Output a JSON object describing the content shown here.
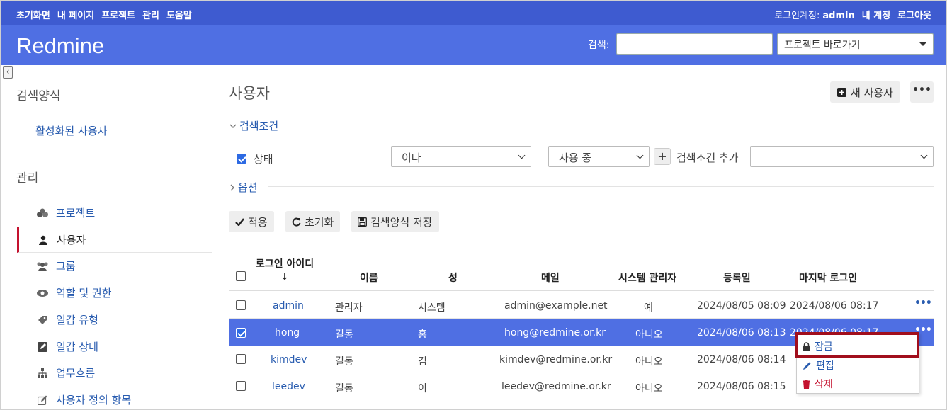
{
  "top_menu": {
    "left": [
      "초기화면",
      "내 페이지",
      "프로젝트",
      "관리",
      "도움말"
    ],
    "login_label": "로그인계정:",
    "login_user": "admin",
    "my_account": "내 계정",
    "logout": "로그아웃"
  },
  "header": {
    "title": "Redmine",
    "search_label": "검색:",
    "search_value": "",
    "jump_label": "프로젝트 바로가기"
  },
  "sidebar": {
    "queries_heading": "검색양식",
    "active_users": "활성화된 사용자",
    "admin_heading": "관리",
    "admin_items": [
      {
        "label": "프로젝트",
        "icon": "projects-icon"
      },
      {
        "label": "사용자",
        "icon": "user-icon"
      },
      {
        "label": "그룹",
        "icon": "group-icon"
      },
      {
        "label": "역할 및 권한",
        "icon": "eye-icon"
      },
      {
        "label": "일감 유형",
        "icon": "tag-icon"
      },
      {
        "label": "일감 상태",
        "icon": "edit-square-icon"
      },
      {
        "label": "업무흐름",
        "icon": "workflow-icon"
      },
      {
        "label": "사용자 정의 항목",
        "icon": "pencil-square-icon"
      }
    ],
    "selected_item": "사용자"
  },
  "main": {
    "title": "사용자",
    "new_user_label": "새 사용자",
    "filters_legend": "검색조건",
    "filter": {
      "label": "상태",
      "operator": "이다",
      "value": "사용 중",
      "add_filter_label": "검색조건 추가",
      "add_filter_value": ""
    },
    "options_legend": "옵션",
    "buttons": {
      "apply": "적용",
      "clear": "초기화",
      "save": "검색양식 저장"
    }
  },
  "table": {
    "headers": {
      "login": "로그인 아이디",
      "sort_mark": "↓",
      "firstname": "이름",
      "lastname": "성",
      "mail": "메일",
      "admin": "시스템 관리자",
      "created": "등록일",
      "last_login": "마지막 로그인"
    },
    "rows": [
      {
        "login": "admin",
        "firstname": "관리자",
        "lastname": "시스템",
        "mail": "admin@example.net",
        "admin": "예",
        "created": "2024/08/05 08:09",
        "last_login": "2024/08/06 08:17",
        "checked": false
      },
      {
        "login": "hong",
        "firstname": "길동",
        "lastname": "홍",
        "mail": "hong@redmine.or.kr",
        "admin": "아니오",
        "created": "2024/08/06 08:13",
        "last_login": "2024/08/06 08:17",
        "checked": true
      },
      {
        "login": "kimdev",
        "firstname": "길동",
        "lastname": "김",
        "mail": "kimdev@redmine.or.kr",
        "admin": "아니오",
        "created": "2024/08/06 08:14",
        "last_login": "",
        "checked": false
      },
      {
        "login": "leedev",
        "firstname": "길동",
        "lastname": "이",
        "mail": "leedev@redmine.or.kr",
        "admin": "아니오",
        "created": "2024/08/06 08:15",
        "last_login": "",
        "checked": false
      }
    ],
    "row_menu": "•••"
  },
  "context_menu": {
    "lock": "잠금",
    "edit": "편집",
    "delete": "삭제"
  },
  "colors": {
    "top_menu_bg": "#3e5bd0",
    "header_bg": "#4f6fe3",
    "link": "#2a5db0",
    "selected_row": "#4f6fe3",
    "highlight_box": "#a10e1c"
  }
}
